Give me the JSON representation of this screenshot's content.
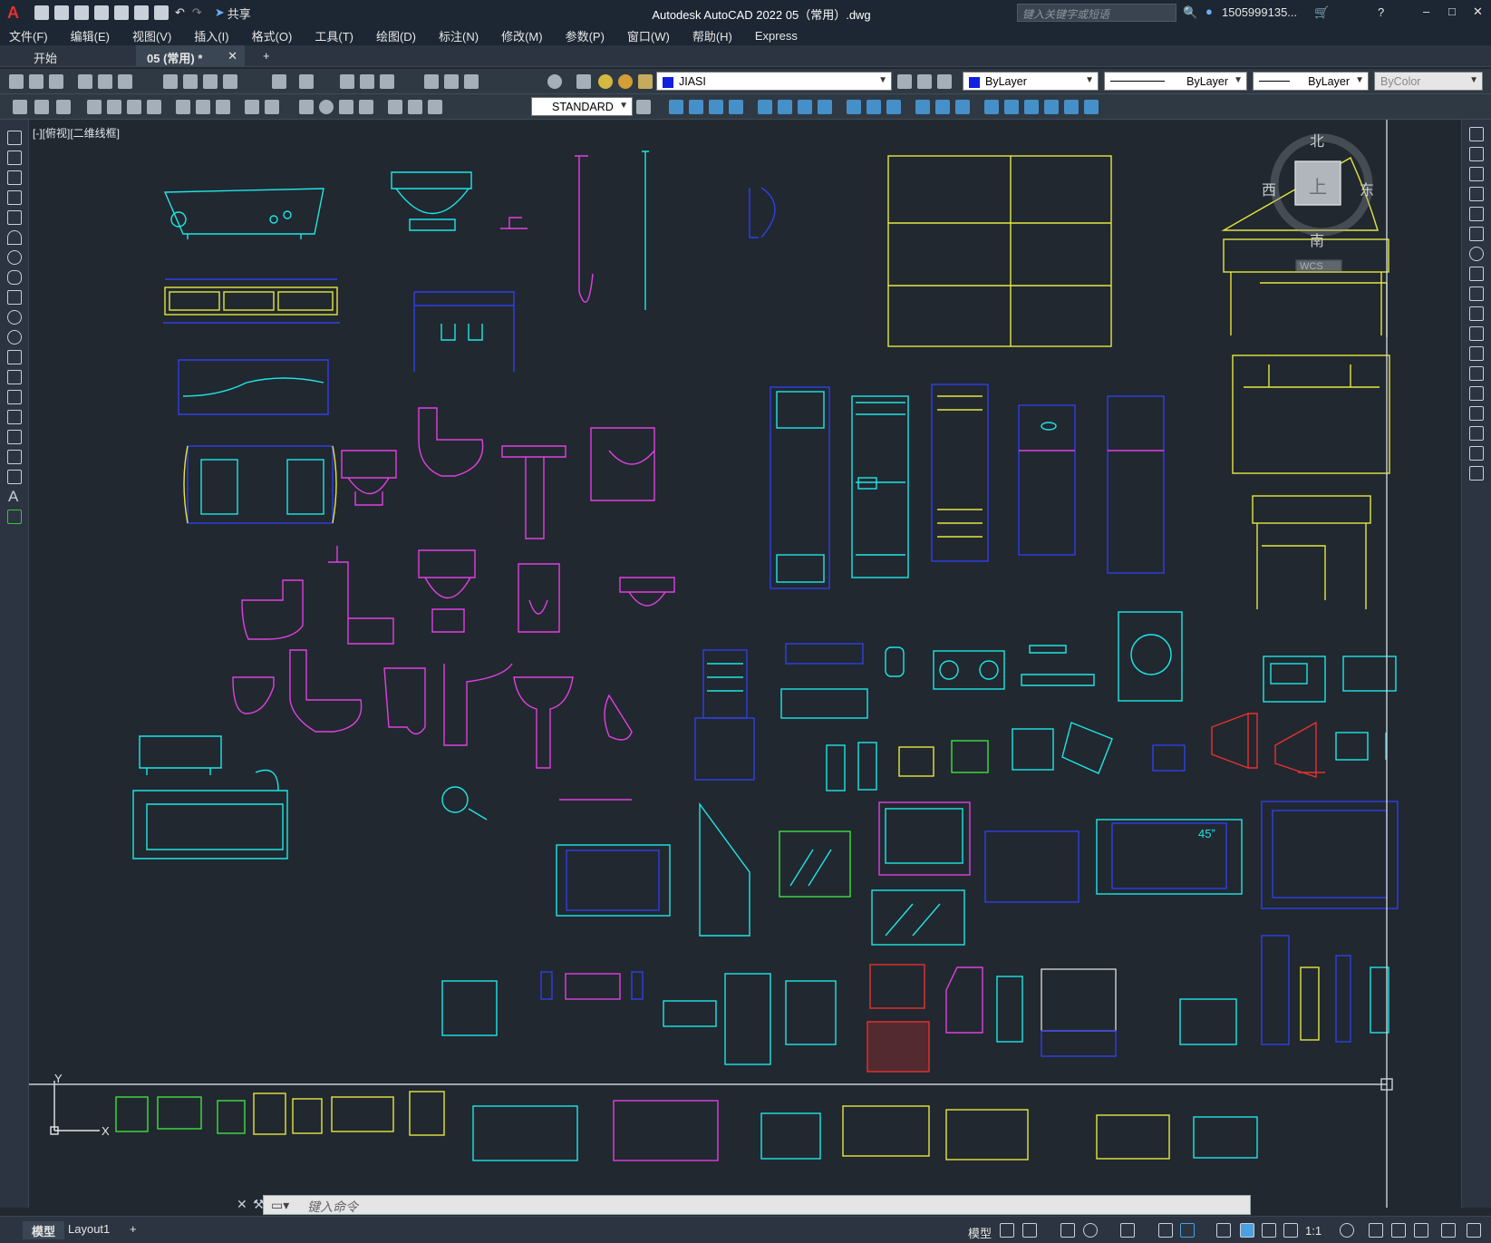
{
  "app": {
    "logo": "A",
    "title": "Autodesk AutoCAD 2022    05（常用）.dwg",
    "share_label": "共享",
    "search_placeholder": "键入关键字或短语",
    "user": "1505999135...",
    "window_controls": [
      "–",
      "□",
      "✕"
    ]
  },
  "menu": [
    "文件(F)",
    "编辑(E)",
    "视图(V)",
    "插入(I)",
    "格式(O)",
    "工具(T)",
    "绘图(D)",
    "标注(N)",
    "修改(M)",
    "参数(P)",
    "窗口(W)",
    "帮助(H)",
    "Express"
  ],
  "file_tabs": {
    "start": "开始",
    "doc": "05 (常用) *",
    "add": "+"
  },
  "toolbar": {
    "layer": "JIASI",
    "color": "ByLayer",
    "linetype": "ByLayer",
    "lineweight": "ByLayer",
    "plotstyle": "ByColor",
    "textstyle": "STANDARD"
  },
  "viewport": {
    "label": "[-][俯视][二维线框]",
    "compass": {
      "n": "北",
      "s": "南",
      "e": "东",
      "w": "西",
      "top": "上",
      "wcs": "WCS"
    },
    "ucs_y": "Y",
    "ucs_x": "X",
    "annotation": "45ˮ"
  },
  "command": {
    "placeholder": "键入命令"
  },
  "status": {
    "tabs": [
      "模型",
      "Layout1",
      "+"
    ],
    "model": "模型",
    "scale": "1:1"
  },
  "colors": {
    "cyan": "#1ee6e6",
    "magenta": "#e040e0",
    "yellow": "#e6e640",
    "blue": "#3040e8",
    "red": "#e83030",
    "green": "#40e040",
    "white": "#d0d0d0"
  }
}
